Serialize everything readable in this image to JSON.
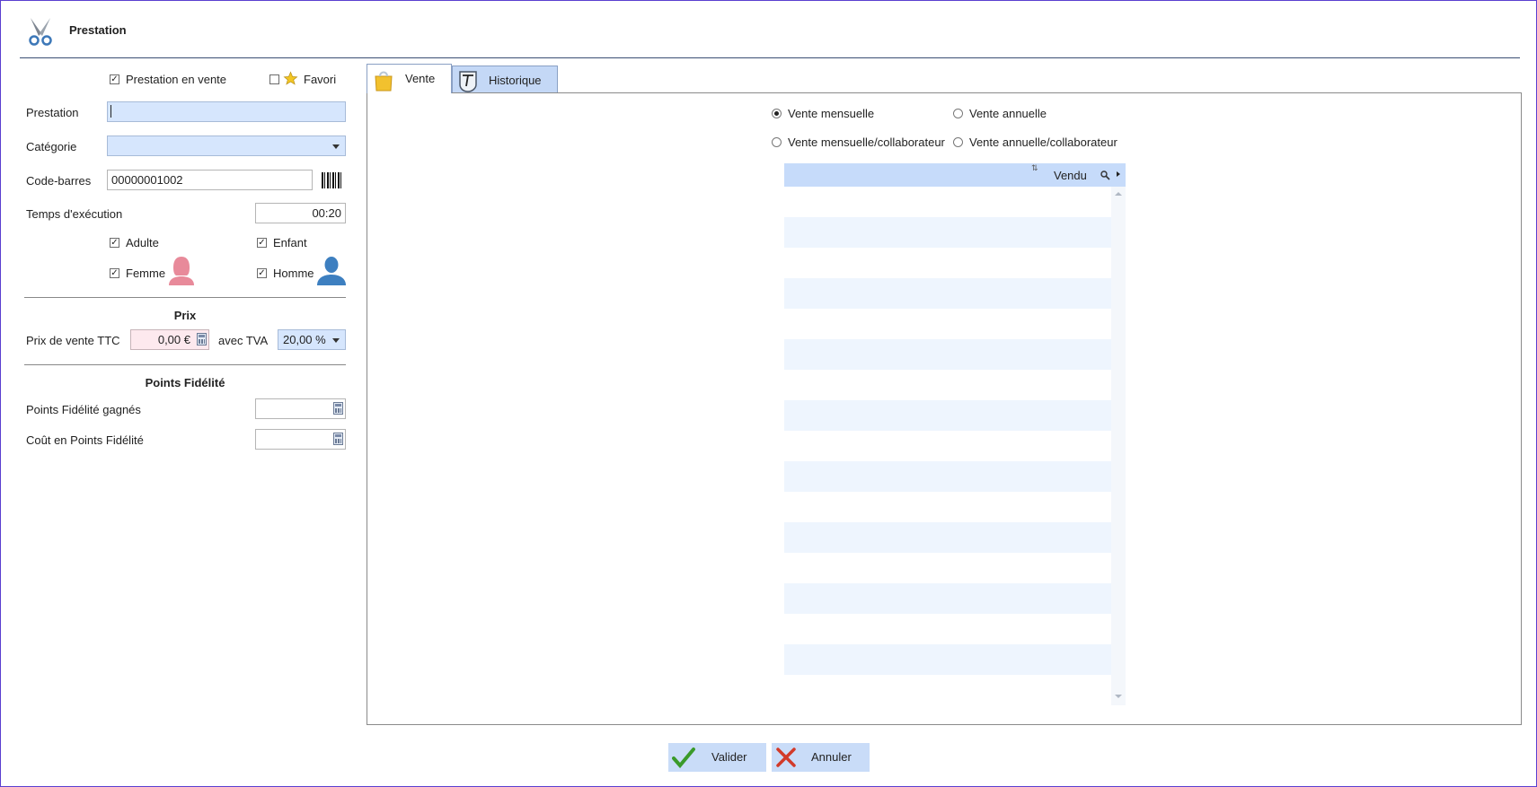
{
  "window": {
    "title": "Prestation"
  },
  "form": {
    "en_vente_label": "Prestation en vente",
    "favori_label": "Favori",
    "prestation_label": "Prestation",
    "prestation_value": "",
    "categorie_label": "Catégorie",
    "categorie_value": "",
    "codebarres_label": "Code-barres",
    "codebarres_value": "00000001002",
    "temps_label": "Temps d'exécution",
    "temps_value": "00:20",
    "adulte_label": "Adulte",
    "enfant_label": "Enfant",
    "femme_label": "Femme",
    "homme_label": "Homme"
  },
  "checks": {
    "en_vente": "✓",
    "favori": "",
    "adulte": "✓",
    "enfant": "✓",
    "femme": "✓",
    "homme": "✓"
  },
  "prix": {
    "section_title": "Prix",
    "ttc_label": "Prix de vente TTC",
    "ttc_value": "0,00 €",
    "tva_label": "avec TVA",
    "tva_value": "20,00 %"
  },
  "fidelite": {
    "section_title": "Points Fidélité",
    "gagnes_label": "Points Fidélité gagnés",
    "gagnes_value": "",
    "cout_label": "Coût en Points Fidélité",
    "cout_value": ""
  },
  "tabs": [
    {
      "label": "Vente",
      "active": true
    },
    {
      "label": "Historique",
      "active": false
    }
  ],
  "vente": {
    "radio_mensuelle": "Vente mensuelle",
    "radio_annuelle": "Vente annuelle",
    "radio_mensuelle_collab": "Vente mensuelle/collaborateur",
    "radio_annuelle_collab": "Vente annuelle/collaborateur",
    "selected": "Vente mensuelle",
    "grid_column": "Vendu",
    "rows": []
  },
  "actions": {
    "valider": "Valider",
    "annuler": "Annuler"
  },
  "colors": {
    "accent": "#c6dbfa",
    "input_focus": "#d6e6fd",
    "price_field": "#fde9ee",
    "femme_icon": "#e88a9a",
    "homme_icon": "#3d7fc0",
    "valider_check": "#3a9a2a",
    "annuler_cross": "#d23a2a"
  }
}
